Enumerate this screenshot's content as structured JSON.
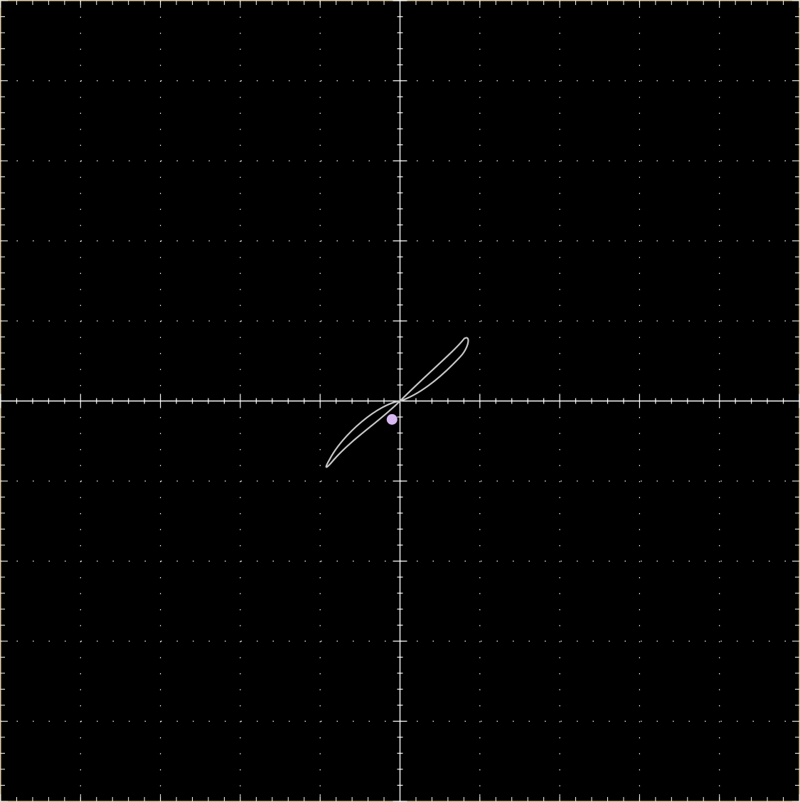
{
  "scope": {
    "divisions": {
      "horizontal": 10,
      "vertical": 10
    },
    "minor_ticks_per_division": 5,
    "graticule_color": "#ffffff",
    "border_color": "#e6d2a8",
    "background_color": "#000000",
    "trace_color": "#c8c8c8",
    "marker_color": "#d8b8f0",
    "trace": {
      "shape": "lissajous-loop",
      "tip_upper_right": [
        0.84,
        0.78
      ],
      "tip_lower_left": [
        -0.94,
        -0.81
      ]
    },
    "marker_point": [
      -0.1,
      -0.23
    ]
  }
}
